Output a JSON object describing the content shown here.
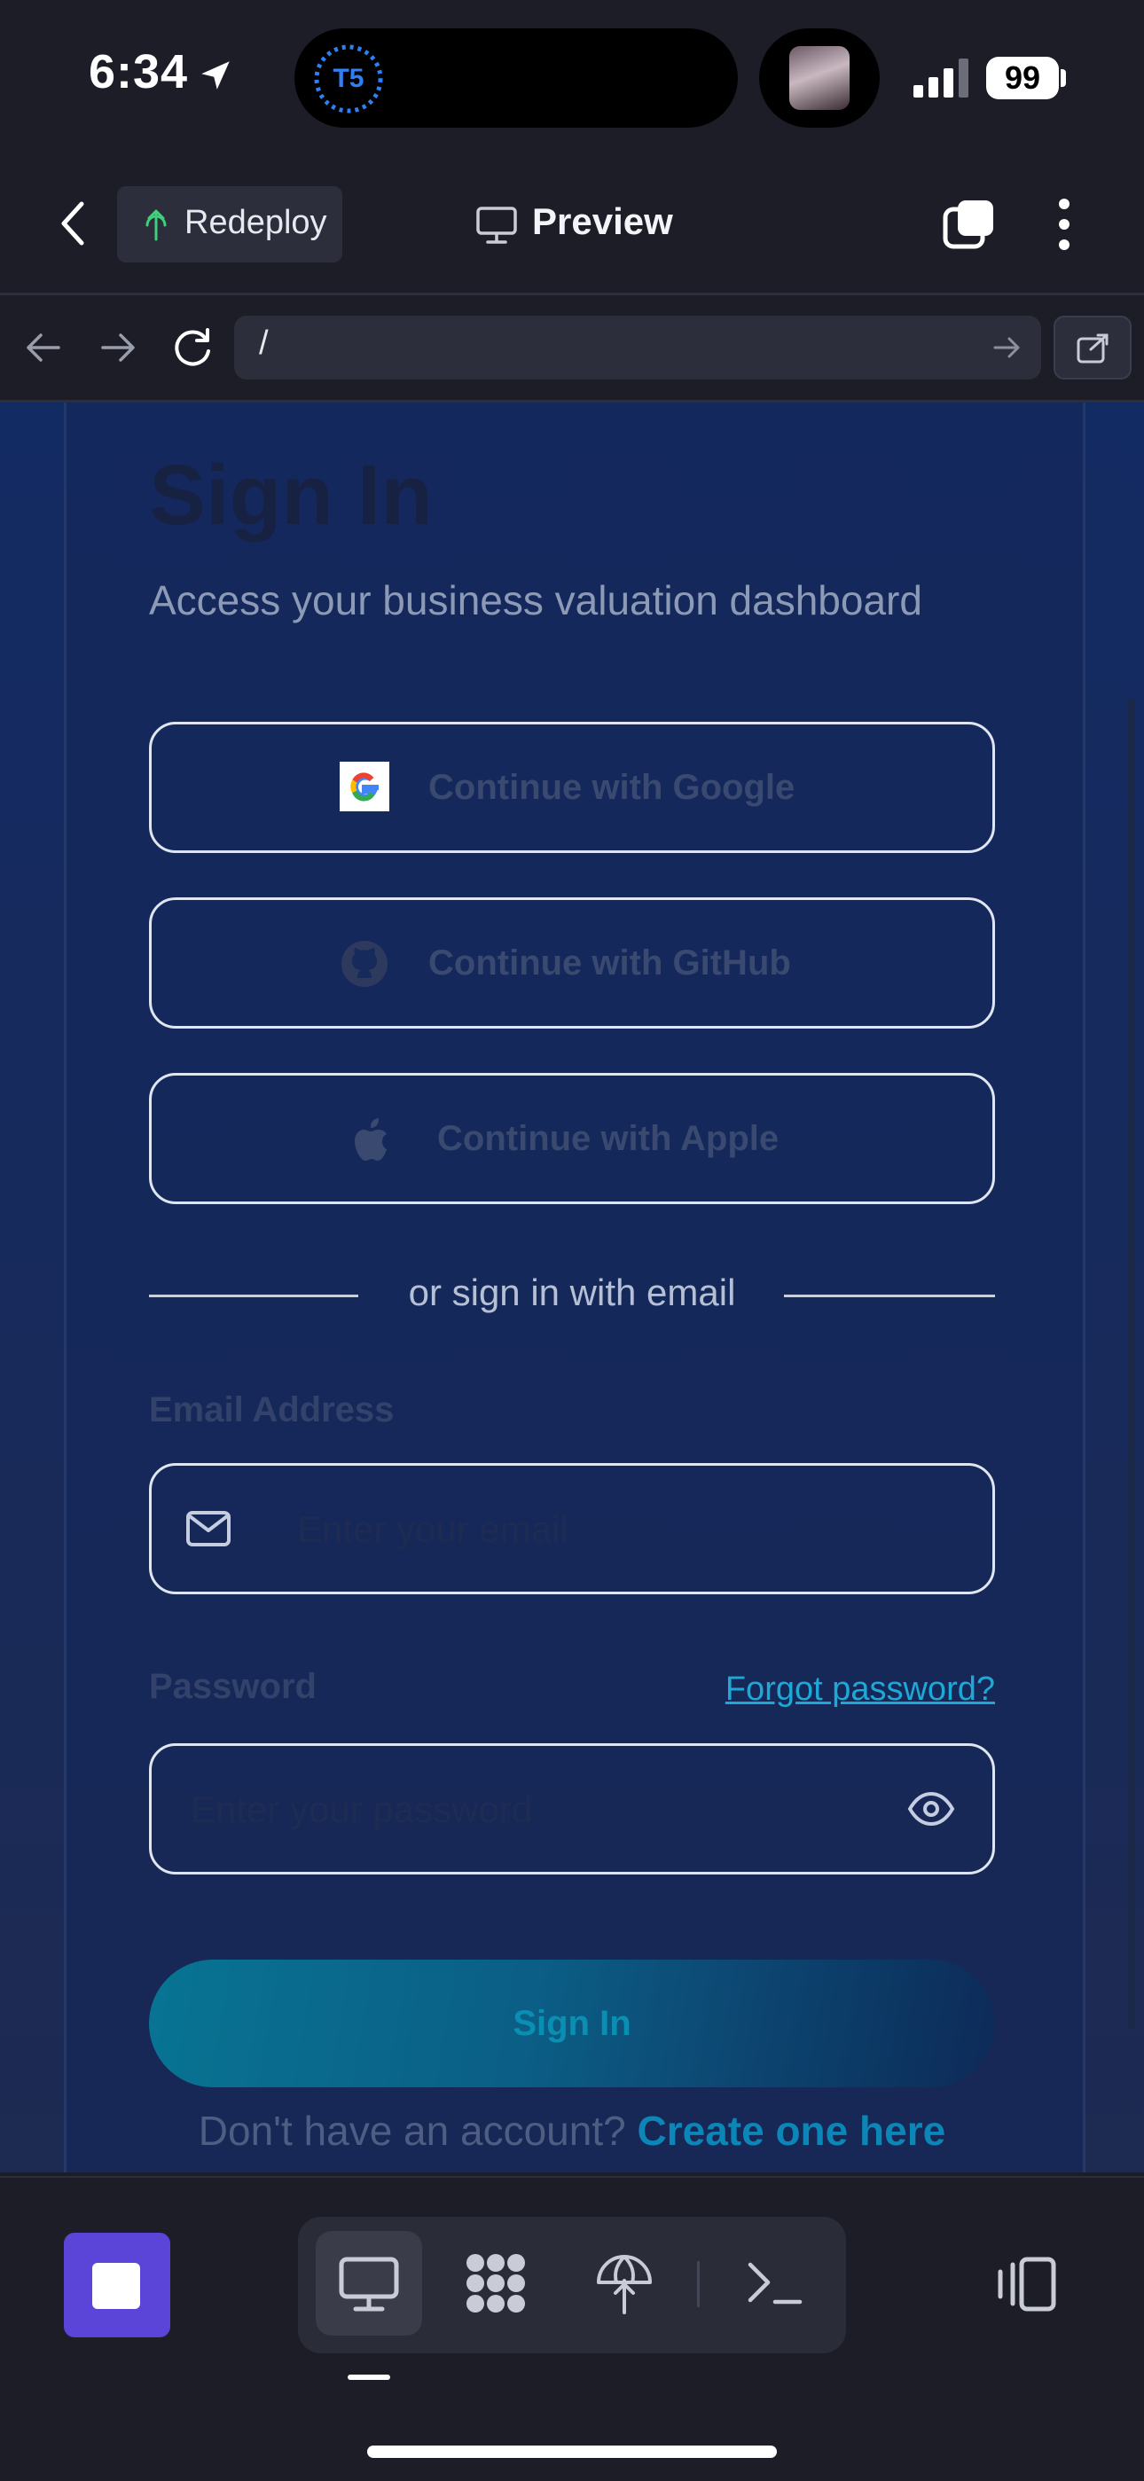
{
  "status_bar": {
    "time": "6:34",
    "battery": "99",
    "island_badge": "T5"
  },
  "header": {
    "redeploy_label": "Redeploy",
    "preview_label": "Preview"
  },
  "url_bar": {
    "url": "/"
  },
  "page": {
    "title": "Sign In",
    "subtitle": "Access your business valuation dashboard",
    "sso": {
      "google": "Continue with Google",
      "github": "Continue with GitHub",
      "apple": "Continue with Apple"
    },
    "divider_text": "or sign in with email",
    "email_label": "Email Address",
    "email_placeholder": "Enter your email",
    "password_label": "Password",
    "password_placeholder": "Enter your password",
    "forgot_password": "Forgot password?",
    "sign_in_button": "Sign In",
    "no_account_text": "Don't have an account? ",
    "create_account_link": "Create one here"
  },
  "colors": {
    "accent_purple": "#5b45d9",
    "link_cyan": "#1ea8d6",
    "page_bg": "#132b63"
  },
  "icons": [
    "location-arrow-icon",
    "signal-icon",
    "battery-icon",
    "back-chevron-icon",
    "redeploy-icon",
    "monitor-icon",
    "tabs-icon",
    "more-vertical-icon",
    "arrow-left-icon",
    "arrow-right-icon",
    "reload-icon",
    "open-external-icon",
    "google-icon",
    "github-icon",
    "apple-icon",
    "mail-icon",
    "eye-icon",
    "stop-icon",
    "desktop-icon",
    "modules-icon",
    "deploy-icon",
    "terminal-icon",
    "panels-icon"
  ]
}
